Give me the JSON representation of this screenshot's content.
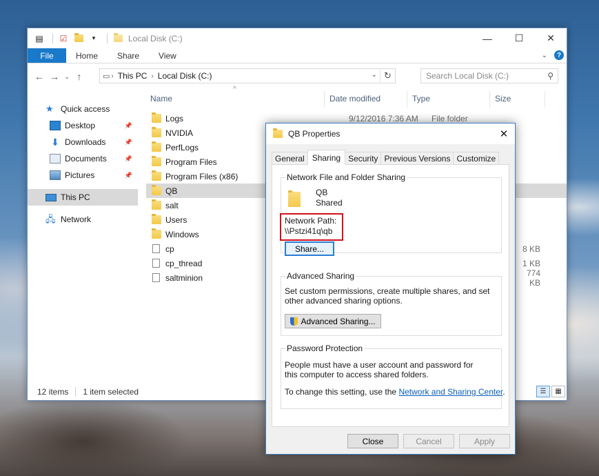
{
  "explorer": {
    "window_title": "Local Disk (C:)",
    "ribbon_tabs": [
      "File",
      "Home",
      "Share",
      "View"
    ],
    "breadcrumb": [
      "This PC",
      "Local Disk (C:)"
    ],
    "search_placeholder": "Search Local Disk (C:)",
    "sidebar": [
      {
        "label": "Quick access",
        "icon": "star-icon"
      },
      {
        "label": "Desktop",
        "icon": "desktop-icon",
        "pinned": true
      },
      {
        "label": "Downloads",
        "icon": "download-icon",
        "pinned": true
      },
      {
        "label": "Documents",
        "icon": "documents-icon",
        "pinned": true
      },
      {
        "label": "Pictures",
        "icon": "pictures-icon",
        "pinned": true
      },
      {
        "label": "This PC",
        "icon": "computer-icon",
        "selected": true
      },
      {
        "label": "Network",
        "icon": "network-icon"
      }
    ],
    "columns": [
      "Name",
      "Date modified",
      "Type",
      "Size"
    ],
    "files": [
      {
        "name": "Logs",
        "date": "9/12/2016 7:36 AM",
        "type": "File folder",
        "size": "",
        "kind": "folder"
      },
      {
        "name": "NVIDIA",
        "date": "",
        "type": "",
        "size": "",
        "kind": "folder"
      },
      {
        "name": "PerfLogs",
        "date": "",
        "type": "",
        "size": "",
        "kind": "folder"
      },
      {
        "name": "Program Files",
        "date": "",
        "type": "",
        "size": "",
        "kind": "folder"
      },
      {
        "name": "Program Files (x86)",
        "date": "",
        "type": "",
        "size": "",
        "kind": "folder"
      },
      {
        "name": "QB",
        "date": "",
        "type": "",
        "size": "",
        "kind": "folder",
        "selected": true
      },
      {
        "name": "salt",
        "date": "",
        "type": "",
        "size": "",
        "kind": "folder"
      },
      {
        "name": "Users",
        "date": "",
        "type": "",
        "size": "",
        "kind": "folder"
      },
      {
        "name": "Windows",
        "date": "",
        "type": "",
        "size": "",
        "kind": "folder"
      },
      {
        "name": "cp",
        "date": "",
        "type": "",
        "size": "8 KB",
        "kind": "file"
      },
      {
        "name": "cp_thread",
        "date": "",
        "type": "",
        "size": "1 KB",
        "kind": "file"
      },
      {
        "name": "saltminion",
        "date": "",
        "type": "",
        "size": "774 KB",
        "kind": "exe"
      }
    ],
    "status_items": "12 items",
    "status_selected": "1 item selected"
  },
  "dialog": {
    "title": "QB Properties",
    "tabs": [
      "General",
      "Sharing",
      "Security",
      "Previous Versions",
      "Customize"
    ],
    "active_tab": "Sharing",
    "network_sharing": {
      "group_label": "Network File and Folder Sharing",
      "folder_name": "QB",
      "folder_state": "Shared",
      "path_label": "Network Path:",
      "path_value": "\\\\Pstzi41q\\qb",
      "share_button": "Share..."
    },
    "advanced": {
      "group_label": "Advanced Sharing",
      "description": "Set custom permissions, create multiple shares, and set other advanced sharing options.",
      "button": "Advanced Sharing..."
    },
    "password": {
      "group_label": "Password Protection",
      "description": "People must have a user account and password for this computer to access shared folders.",
      "change_prefix": "To change this setting, use the ",
      "link": "Network and Sharing Center",
      "change_suffix": "."
    },
    "buttons": {
      "close": "Close",
      "cancel": "Cancel",
      "apply": "Apply"
    }
  }
}
